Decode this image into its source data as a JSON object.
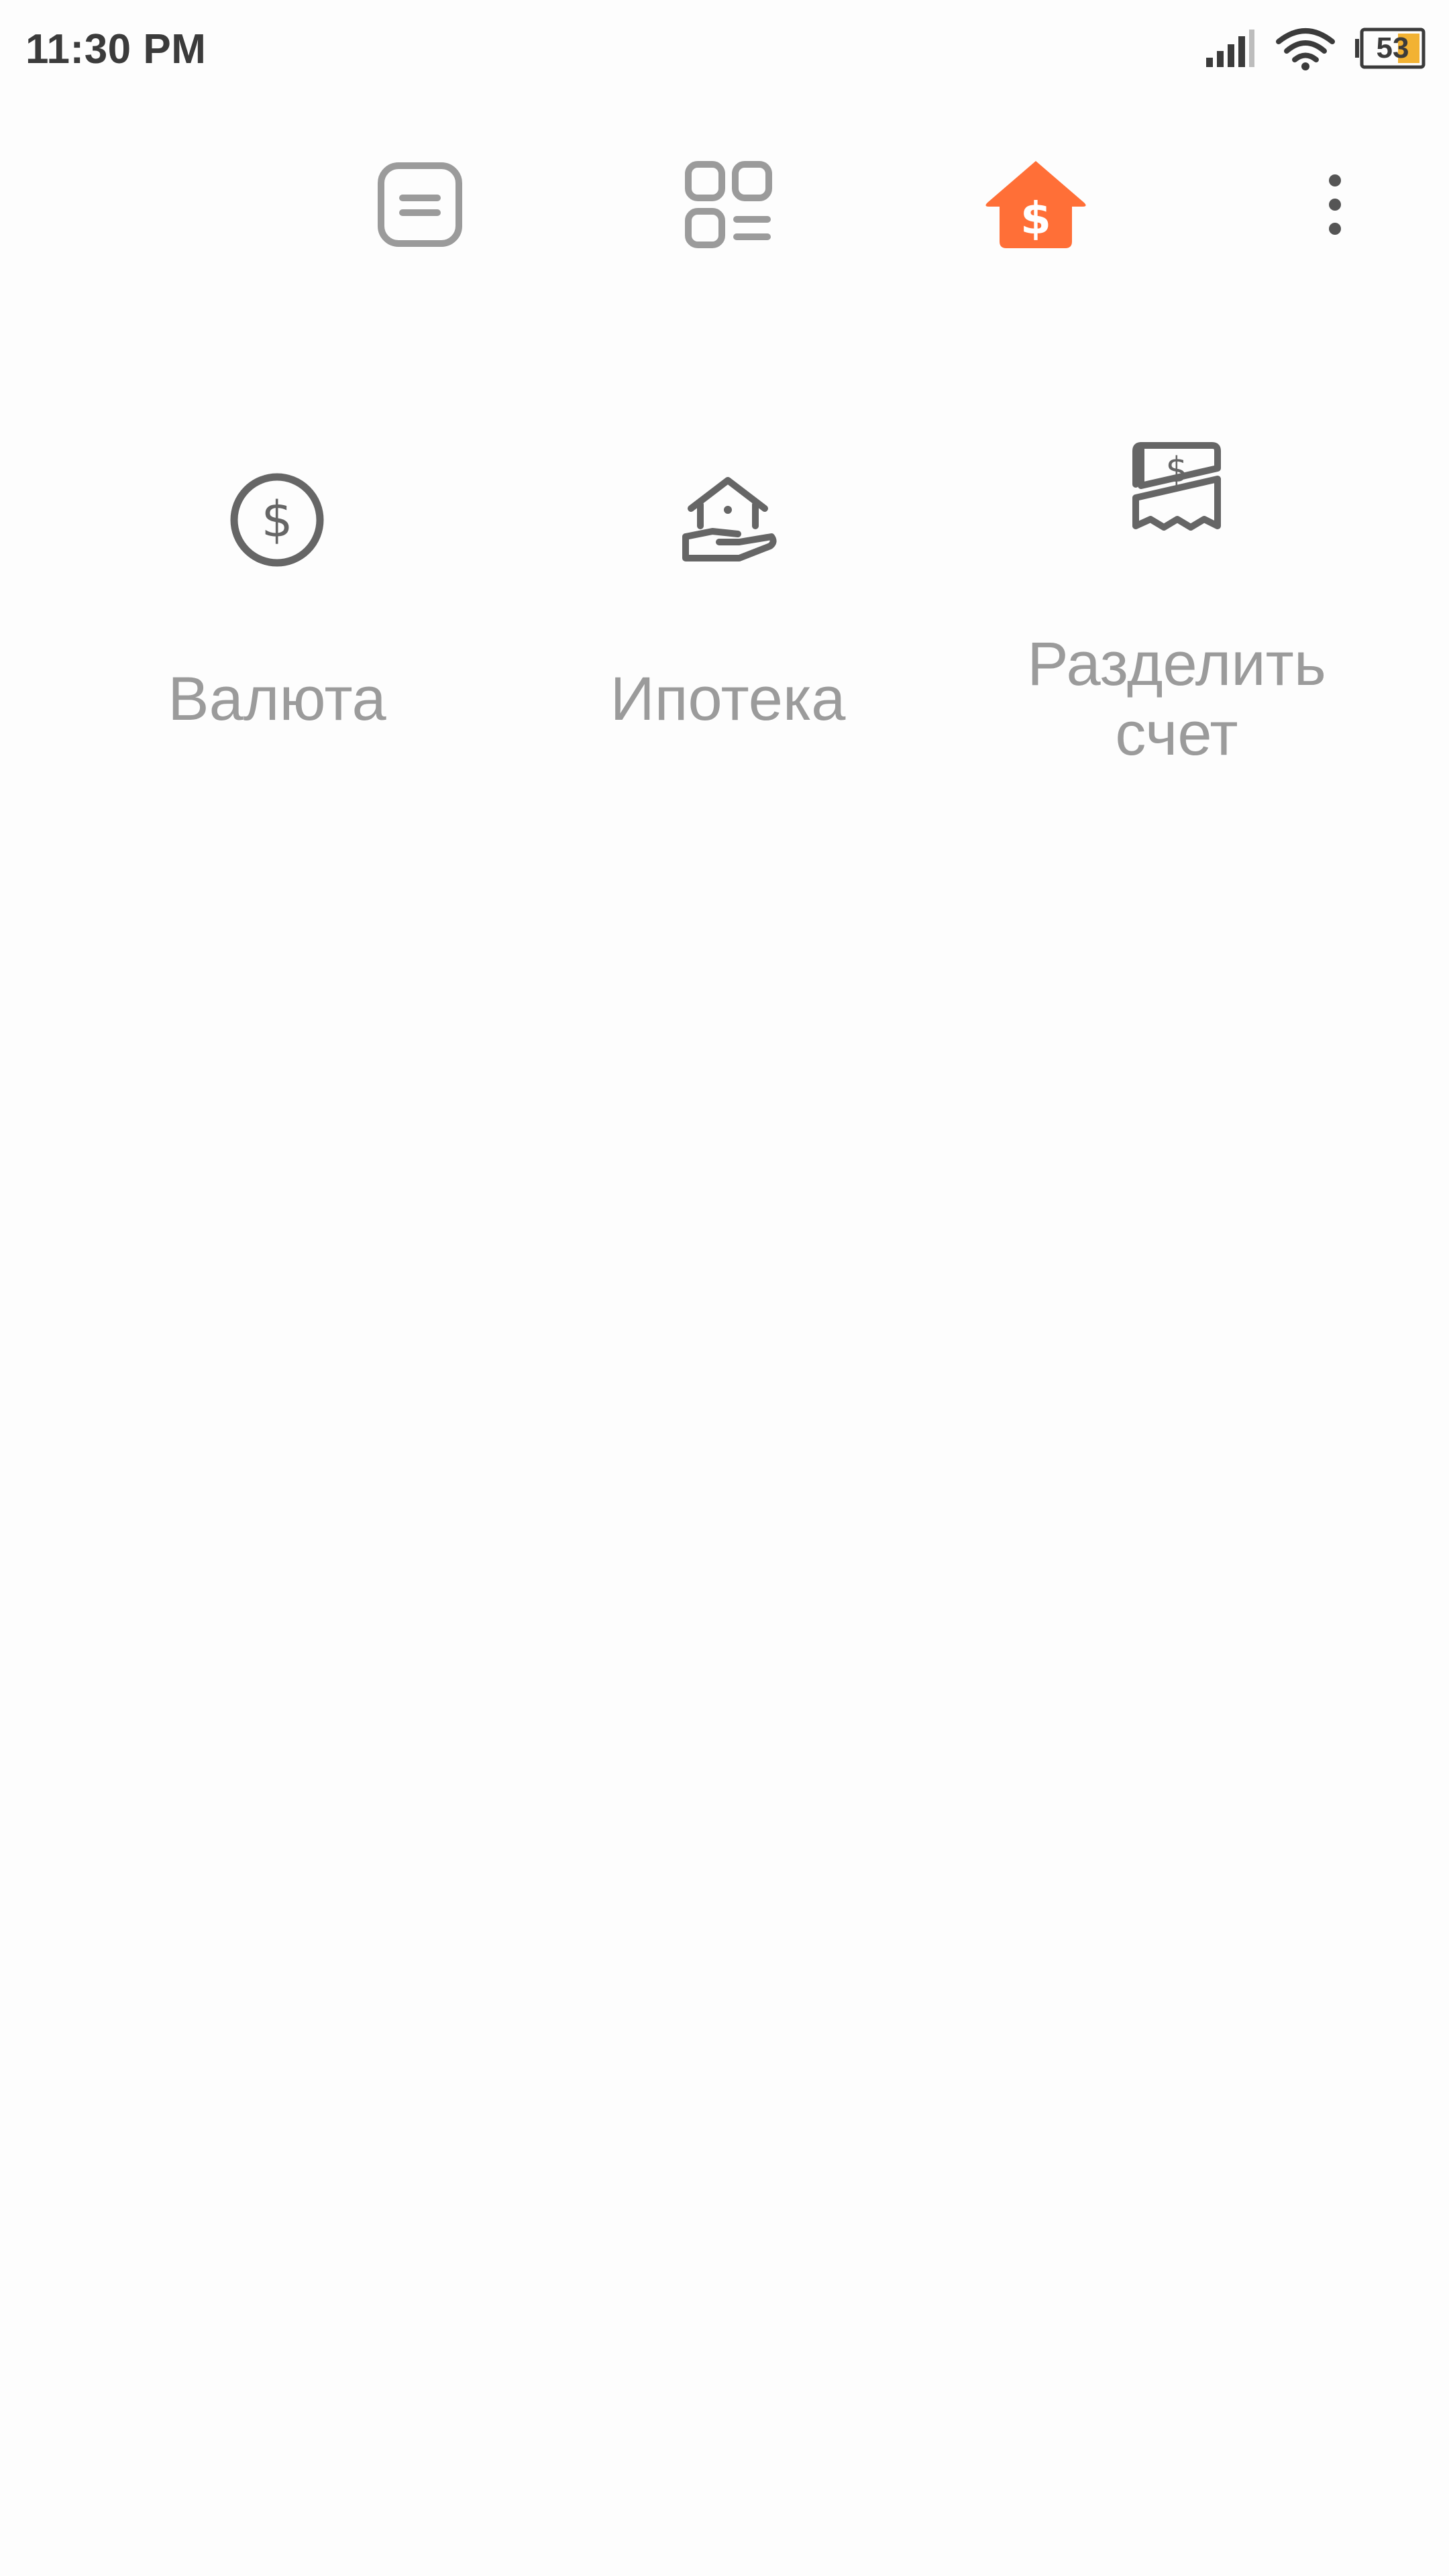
{
  "status_bar": {
    "time": "11:30 PM",
    "battery_level": "53",
    "icons": [
      "signal-icon",
      "wifi-icon",
      "battery-icon"
    ]
  },
  "toolbar": {
    "items": [
      {
        "icon": "notes-icon"
      },
      {
        "icon": "apps-grid-icon"
      },
      {
        "icon": "finance-home-icon",
        "active": true
      },
      {
        "icon": "more-vertical-icon"
      }
    ],
    "accent_color": "#ff6f37",
    "inactive_color": "#9b9b9b"
  },
  "tools": [
    {
      "icon": "currency-dollar-icon",
      "label": "Валюта"
    },
    {
      "icon": "mortgage-house-hand-icon",
      "label": "Ипотека"
    },
    {
      "icon": "split-bill-icon",
      "label": "Разделить счет"
    }
  ],
  "colors": {
    "background": "#fdfdfd",
    "label_gray": "#9b9b9b",
    "icon_gray": "#666666"
  }
}
